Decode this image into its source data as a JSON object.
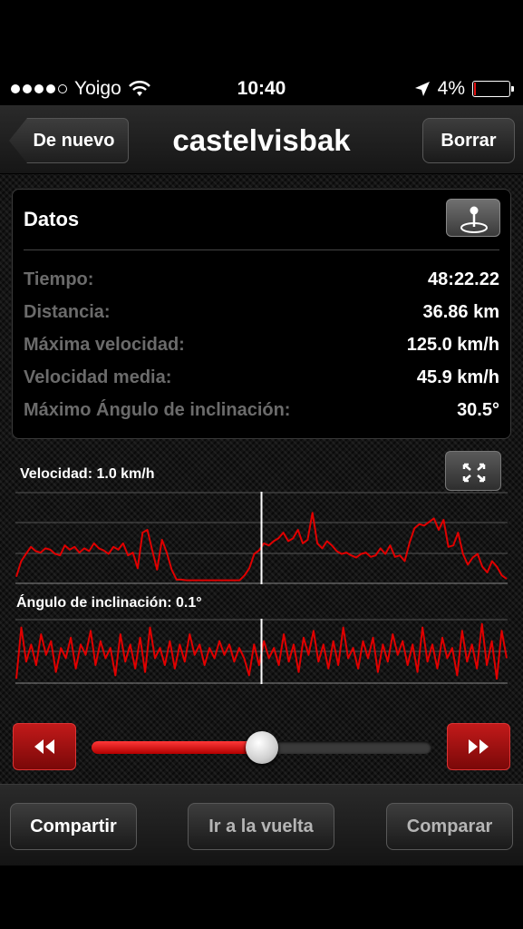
{
  "status_bar": {
    "carrier": "Yoigo",
    "time": "10:40",
    "battery": "4%",
    "battery_level": 0.04,
    "signal_bars": 4
  },
  "nav": {
    "back_label": "De nuevo",
    "title": "castelvisbak",
    "delete_label": "Borrar"
  },
  "datos": {
    "title": "Datos",
    "rows": [
      {
        "label": "Tiempo:",
        "value": "48:22.22"
      },
      {
        "label": "Distancia:",
        "value": "36.86 km"
      },
      {
        "label": "Máxima velocidad:",
        "value": "125.0 km/h"
      },
      {
        "label": "Velocidad media:",
        "value": "45.9 km/h"
      },
      {
        "label": "Máximo Ángulo de inclinación:",
        "value": "30.5°"
      }
    ]
  },
  "charts": {
    "speed_label": "Velocidad: 1.0 km/h",
    "lean_label": "Ángulo de inclinación: 0.1°"
  },
  "chart_data": [
    {
      "type": "line",
      "series": [
        {
          "values": [
            8,
            30,
            40,
            50,
            44,
            42,
            48,
            46,
            40,
            38,
            52,
            46,
            50,
            42,
            48,
            44,
            55,
            48,
            45,
            40,
            50,
            46,
            55,
            38,
            42,
            20,
            70,
            74,
            45,
            18,
            60,
            42,
            18,
            4,
            4,
            3,
            3,
            3,
            3,
            3,
            3,
            3,
            3,
            3,
            3,
            3,
            3,
            10,
            20,
            40,
            45,
            55,
            52,
            58,
            62,
            70,
            58,
            62,
            74,
            55,
            60,
            98,
            55,
            48,
            58,
            52,
            44,
            40,
            42,
            38,
            35,
            40,
            42,
            36,
            38,
            48,
            40,
            52,
            36,
            38,
            30,
            56,
            76,
            82,
            80,
            85,
            90,
            74,
            88,
            50,
            52,
            70,
            40,
            25,
            35,
            40,
            22,
            14,
            30,
            22,
            10,
            5
          ]
        }
      ],
      "cursor_fraction": 0.5,
      "ylim": [
        0,
        125
      ]
    },
    {
      "type": "line",
      "series": [
        {
          "values": [
            -40,
            35,
            -15,
            10,
            -20,
            25,
            -5,
            15,
            -30,
            5,
            -10,
            20,
            -25,
            10,
            -5,
            30,
            -20,
            15,
            -10,
            5,
            -35,
            25,
            -15,
            10,
            -25,
            20,
            -30,
            35,
            -10,
            5,
            -20,
            15,
            -25,
            10,
            -15,
            25,
            -5,
            10,
            -20,
            5,
            -10,
            15,
            -5,
            10,
            -15,
            5,
            -10,
            -35,
            10,
            -20,
            15,
            -10,
            5,
            -20,
            25,
            -15,
            10,
            -30,
            20,
            -5,
            30,
            -15,
            10,
            -25,
            15,
            -20,
            35,
            -10,
            5,
            -25,
            15,
            -10,
            20,
            -30,
            10,
            -15,
            25,
            -5,
            15,
            -20,
            10,
            -30,
            35,
            -15,
            10,
            -25,
            20,
            -10,
            5,
            -35,
            30,
            -15,
            10,
            -25,
            40,
            -20,
            15,
            -40,
            30,
            -10
          ]
        }
      ],
      "cursor_fraction": 0.5,
      "ylim": [
        -45,
        45
      ]
    }
  ],
  "playback": {
    "rewind_icon": "rewind-icon",
    "forward_icon": "fast-forward-icon",
    "progress": 0.5
  },
  "toolbar": {
    "share_label": "Compartir",
    "lap_label": "Ir a la vuelta",
    "compare_label": "Comparar"
  },
  "colors": {
    "accent_red": "#e00000",
    "label_gray": "#6b6b6b"
  }
}
